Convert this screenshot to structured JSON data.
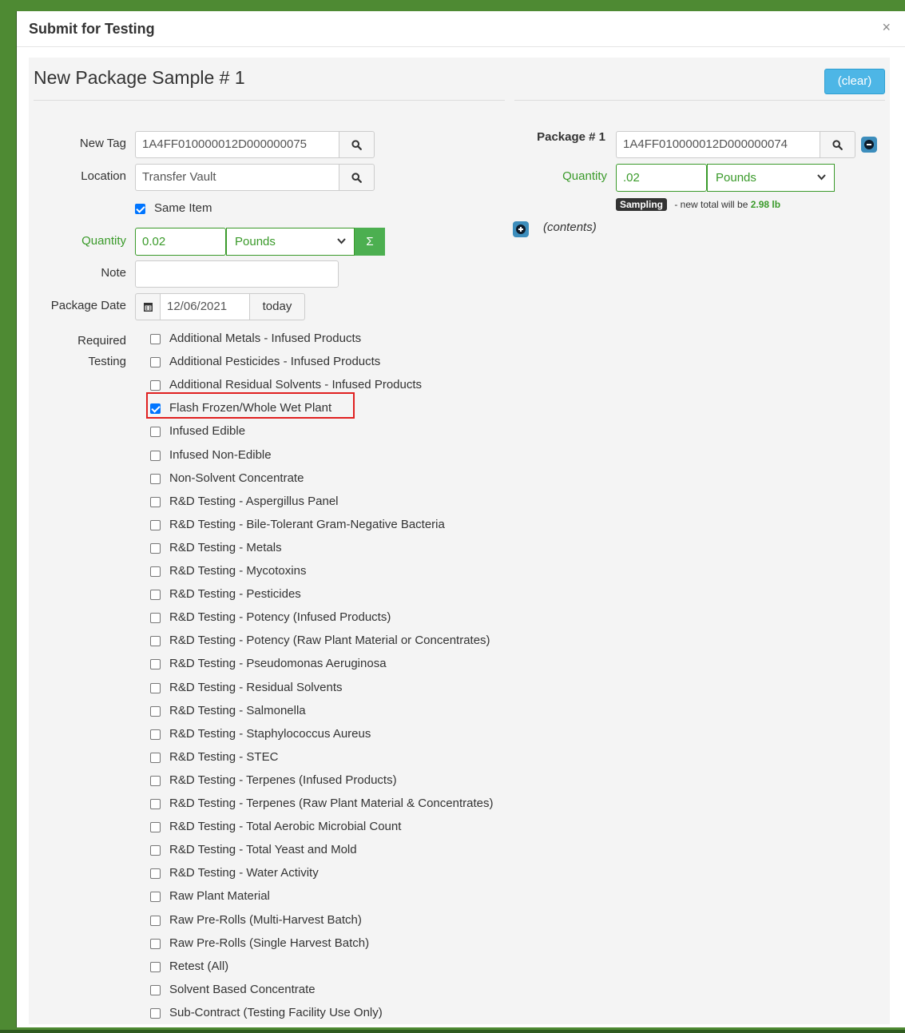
{
  "modal": {
    "title": "Submit for Testing",
    "close_label": "×"
  },
  "form": {
    "section_title": "New Package Sample # 1",
    "clear_label": "(clear)",
    "new_tag": {
      "label": "New Tag",
      "value": "1A4FF010000012D000000075"
    },
    "location": {
      "label": "Location",
      "value": "Transfer Vault"
    },
    "same_item": {
      "label": "Same Item",
      "checked": true
    },
    "quantity": {
      "label": "Quantity",
      "value": "0.02",
      "unit": "Pounds",
      "sigma": "Σ"
    },
    "note": {
      "label": "Note",
      "value": ""
    },
    "package_date": {
      "label": "Package Date",
      "value": "12/06/2021",
      "today_label": "today"
    },
    "required_testing": {
      "label_line1": "Required",
      "label_line2": "Testing",
      "options": [
        {
          "label": "Additional Metals - Infused Products",
          "checked": false
        },
        {
          "label": "Additional Pesticides - Infused Products",
          "checked": false
        },
        {
          "label": "Additional Residual Solvents - Infused Products",
          "checked": false
        },
        {
          "label": "Flash Frozen/Whole Wet Plant",
          "checked": true
        },
        {
          "label": "Infused Edible",
          "checked": false
        },
        {
          "label": "Infused Non-Edible",
          "checked": false
        },
        {
          "label": "Non-Solvent Concentrate",
          "checked": false
        },
        {
          "label": "R&D Testing - Aspergillus Panel",
          "checked": false
        },
        {
          "label": "R&D Testing - Bile-Tolerant Gram-Negative Bacteria",
          "checked": false
        },
        {
          "label": "R&D Testing - Metals",
          "checked": false
        },
        {
          "label": "R&D Testing - Mycotoxins",
          "checked": false
        },
        {
          "label": "R&D Testing - Pesticides",
          "checked": false
        },
        {
          "label": "R&D Testing - Potency (Infused Products)",
          "checked": false
        },
        {
          "label": "R&D Testing - Potency (Raw Plant Material or Concentrates)",
          "checked": false
        },
        {
          "label": "R&D Testing - Pseudomonas Aeruginosa",
          "checked": false
        },
        {
          "label": "R&D Testing - Residual Solvents",
          "checked": false
        },
        {
          "label": "R&D Testing - Salmonella",
          "checked": false
        },
        {
          "label": "R&D Testing - Staphylococcus Aureus",
          "checked": false
        },
        {
          "label": "R&D Testing - STEC",
          "checked": false
        },
        {
          "label": "R&D Testing - Terpenes (Infused Products)",
          "checked": false
        },
        {
          "label": "R&D Testing - Terpenes (Raw Plant Material & Concentrates)",
          "checked": false
        },
        {
          "label": "R&D Testing - Total Aerobic Microbial Count",
          "checked": false
        },
        {
          "label": "R&D Testing - Total Yeast and Mold",
          "checked": false
        },
        {
          "label": "R&D Testing - Water Activity",
          "checked": false
        },
        {
          "label": "Raw Plant Material",
          "checked": false
        },
        {
          "label": "Raw Pre-Rolls (Multi-Harvest Batch)",
          "checked": false
        },
        {
          "label": "Raw Pre-Rolls (Single Harvest Batch)",
          "checked": false
        },
        {
          "label": "Retest (All)",
          "checked": false
        },
        {
          "label": "Solvent Based Concentrate",
          "checked": false
        },
        {
          "label": "Sub-Contract (Testing Facility Use Only)",
          "checked": false
        }
      ]
    }
  },
  "package": {
    "label": "Package # 1",
    "tag": "1A4FF010000012D000000074",
    "quantity_label": "Quantity",
    "quantity": ".02",
    "unit": "Pounds",
    "badge": "Sampling",
    "total_prefix": " - new total will be ",
    "total_value": "2.98 lb",
    "contents_label": "(contents)"
  },
  "colors": {
    "accent_green": "#3a9a2a",
    "info_blue": "#4db6e6",
    "checkbox_blue": "#0075ff",
    "highlight_red": "#e02020"
  }
}
